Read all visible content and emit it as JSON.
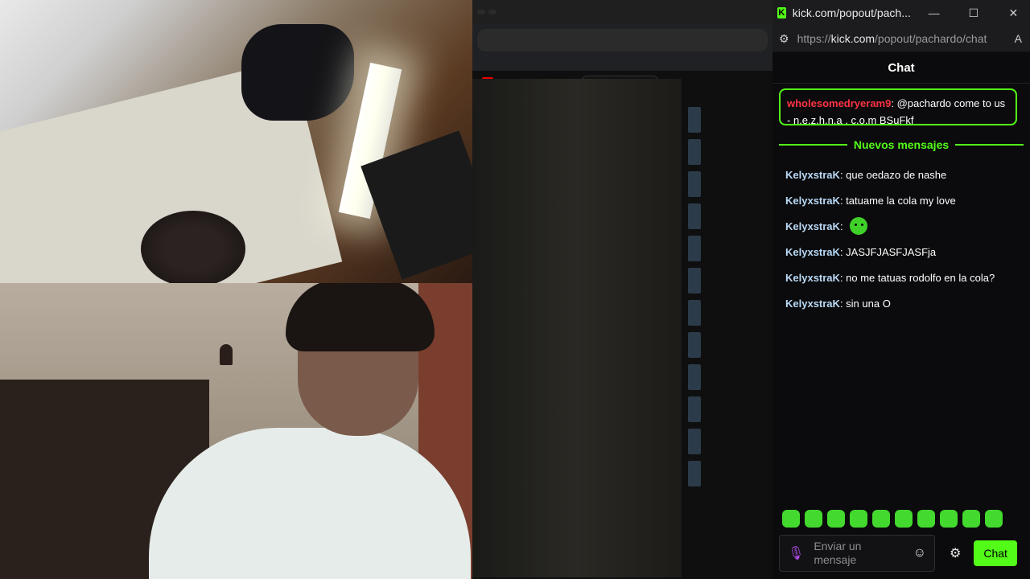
{
  "window": {
    "title": "kick.com/popout/pach...",
    "controls": {
      "minimize": "—",
      "maximize": "☐",
      "close": "✕"
    }
  },
  "urlbar": {
    "prefix": "https://",
    "host": "kick.com",
    "path": "/popout/pachardo/chat",
    "reader": "A"
  },
  "chat": {
    "header": "Chat",
    "pinned": {
      "user": "wholesomedryeram9",
      "text": ": @pachardo come to us - n.e.z.h.n.a . c.o.m BSuFkf"
    },
    "new_messages_label": "Nuevos mensajes",
    "messages": [
      {
        "user": "KelyxstraK",
        "text": ": que oedazo de nashe"
      },
      {
        "user": "KelyxstraK",
        "text": ": tatuame la cola my love"
      },
      {
        "user": "KelyxstraK",
        "text": ":"
      },
      {
        "user": "KelyxstraK",
        "text": ": JASJFJASFJASFja"
      },
      {
        "user": "KelyxstraK",
        "text": ": no me tatuas rodolfo en la cola?"
      },
      {
        "user": "KelyxstraK",
        "text": ": sin una O"
      }
    ],
    "input_placeholder": "Enviar un mensaje",
    "send_label": "Chat"
  },
  "colors": {
    "accent": "#53fc18",
    "pinned_user": "#ff3344",
    "username": "#b9d9f6"
  }
}
